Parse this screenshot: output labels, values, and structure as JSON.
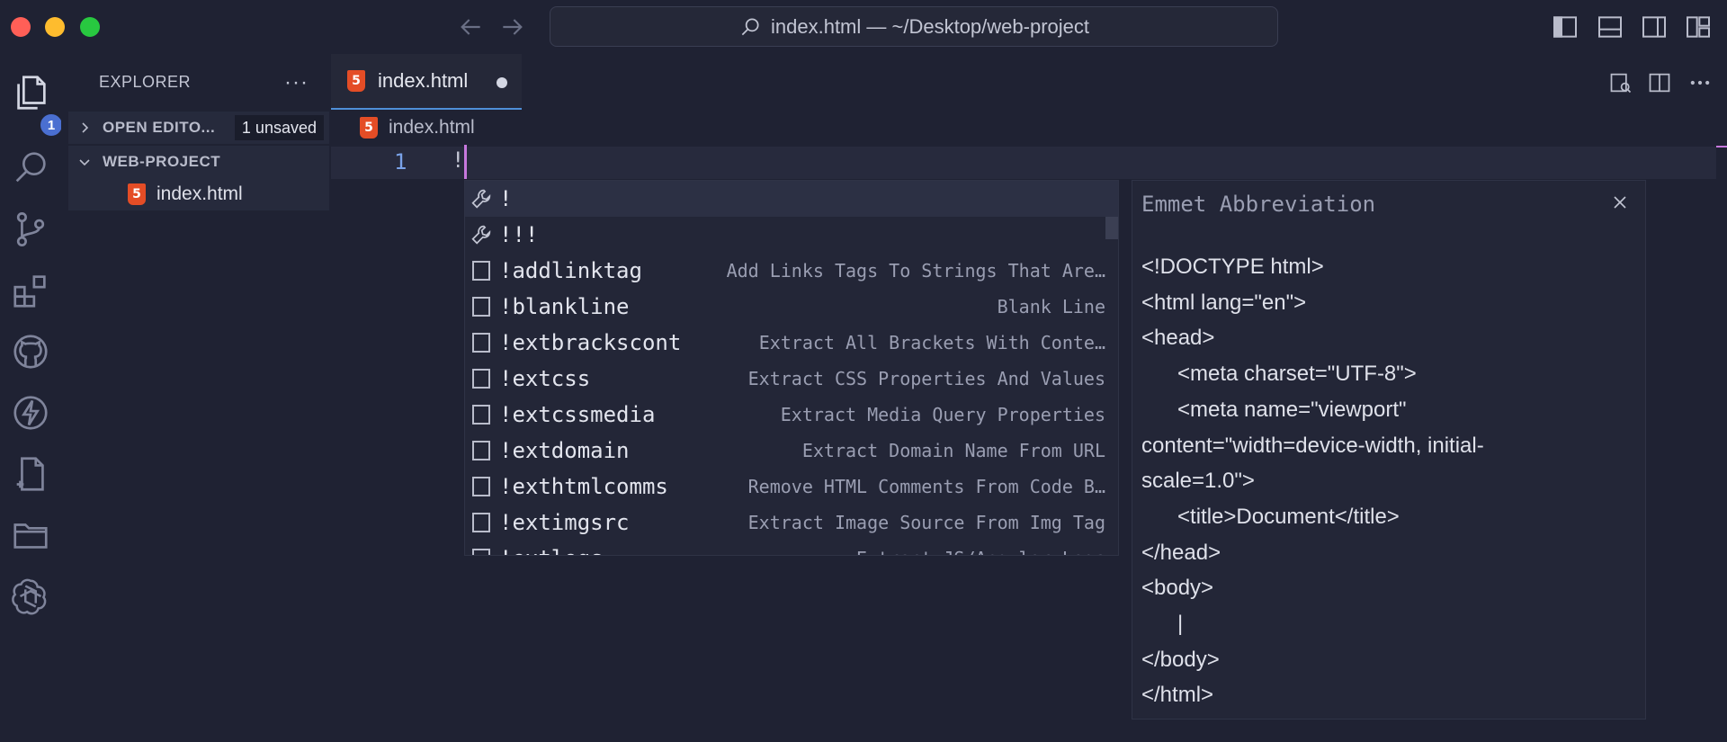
{
  "window": {
    "command_center": "index.html — ~/Desktop/web-project"
  },
  "activity_bar": {
    "explorer_badge": "1"
  },
  "sidebar": {
    "header": "EXPLORER",
    "open_editors_label": "OPEN EDITO...",
    "unsaved_badge": "1 unsaved",
    "project_label": "WEB-PROJECT",
    "files": [
      {
        "name": "index.html",
        "icon": "html5-icon"
      }
    ]
  },
  "editor": {
    "tab_label": "index.html",
    "breadcrumb": "index.html",
    "line_number": "1",
    "line_text": "!"
  },
  "suggest": {
    "items": [
      {
        "label": "!",
        "detail": "",
        "icon": "wrench-icon"
      },
      {
        "label": "!!!",
        "detail": "",
        "icon": "wrench-icon"
      },
      {
        "label": "!addlinktag",
        "detail": "Add Links Tags To Strings That Are…",
        "icon": "snippet-icon"
      },
      {
        "label": "!blankline",
        "detail": "Blank Line",
        "icon": "snippet-icon"
      },
      {
        "label": "!extbrackscont",
        "detail": "Extract All Brackets With Conte…",
        "icon": "snippet-icon"
      },
      {
        "label": "!extcss",
        "detail": "Extract CSS Properties And Values",
        "icon": "snippet-icon"
      },
      {
        "label": "!extcssmedia",
        "detail": "Extract Media Query Properties",
        "icon": "snippet-icon"
      },
      {
        "label": "!extdomain",
        "detail": "Extract Domain Name From URL",
        "icon": "snippet-icon"
      },
      {
        "label": "!exthtmlcomms",
        "detail": "Remove HTML Comments From Code B…",
        "icon": "snippet-icon"
      },
      {
        "label": "!extimgsrc",
        "detail": "Extract Image Source From Img Tag",
        "icon": "snippet-icon"
      },
      {
        "label": "!extlogs",
        "detail": "Extract JS/Angular Logs",
        "icon": "snippet-icon"
      }
    ]
  },
  "details": {
    "title": "Emmet Abbreviation",
    "lines": [
      "<!DOCTYPE html>",
      "<html lang=\"en\">",
      "<head>",
      "\t<meta charset=\"UTF-8\">",
      "\t<meta name=\"viewport\"",
      "content=\"width=device-width, initial-",
      "scale=1.0\">",
      "\t<title>Document</title>",
      "</head>",
      "<body>",
      "\t|",
      "</body>",
      "</html>"
    ]
  },
  "colors": {
    "background": "#1f2233",
    "accent": "#4f8fd8",
    "cursor": "#c678dd",
    "html5": "#e44d26",
    "badge": "#4a6fd1"
  }
}
